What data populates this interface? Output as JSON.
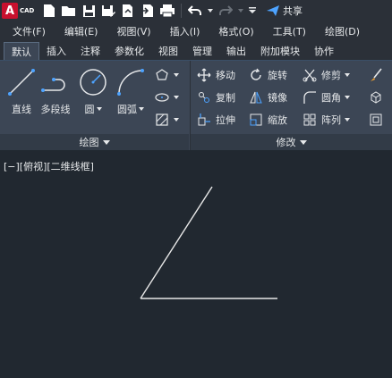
{
  "app": {
    "logo_letter": "A",
    "logo_text": "CAD"
  },
  "quick_access": {
    "share_label": "共享"
  },
  "menu": [
    "文件(F)",
    "编辑(E)",
    "视图(V)",
    "插入(I)",
    "格式(O)",
    "工具(T)",
    "绘图(D)"
  ],
  "tabs": [
    "默认",
    "插入",
    "注释",
    "参数化",
    "视图",
    "管理",
    "输出",
    "附加模块",
    "协作"
  ],
  "active_tab": "默认",
  "draw_panel": {
    "title": "绘图",
    "line": "直线",
    "polyline": "多段线",
    "circle": "圆",
    "arc": "圆弧"
  },
  "modify_panel": {
    "title": "修改",
    "move": "移动",
    "rotate": "旋转",
    "trim": "修剪",
    "copy": "复制",
    "mirror": "镜像",
    "fillet": "圆角",
    "stretch": "拉伸",
    "scale": "缩放",
    "array": "阵列"
  },
  "viewport": {
    "label": "[−][俯视][二维线框]"
  },
  "colors": {
    "accent": "#c8102e",
    "canvas": "#212830",
    "ribbon": "#3c4655",
    "titlebar": "#2b3038"
  }
}
